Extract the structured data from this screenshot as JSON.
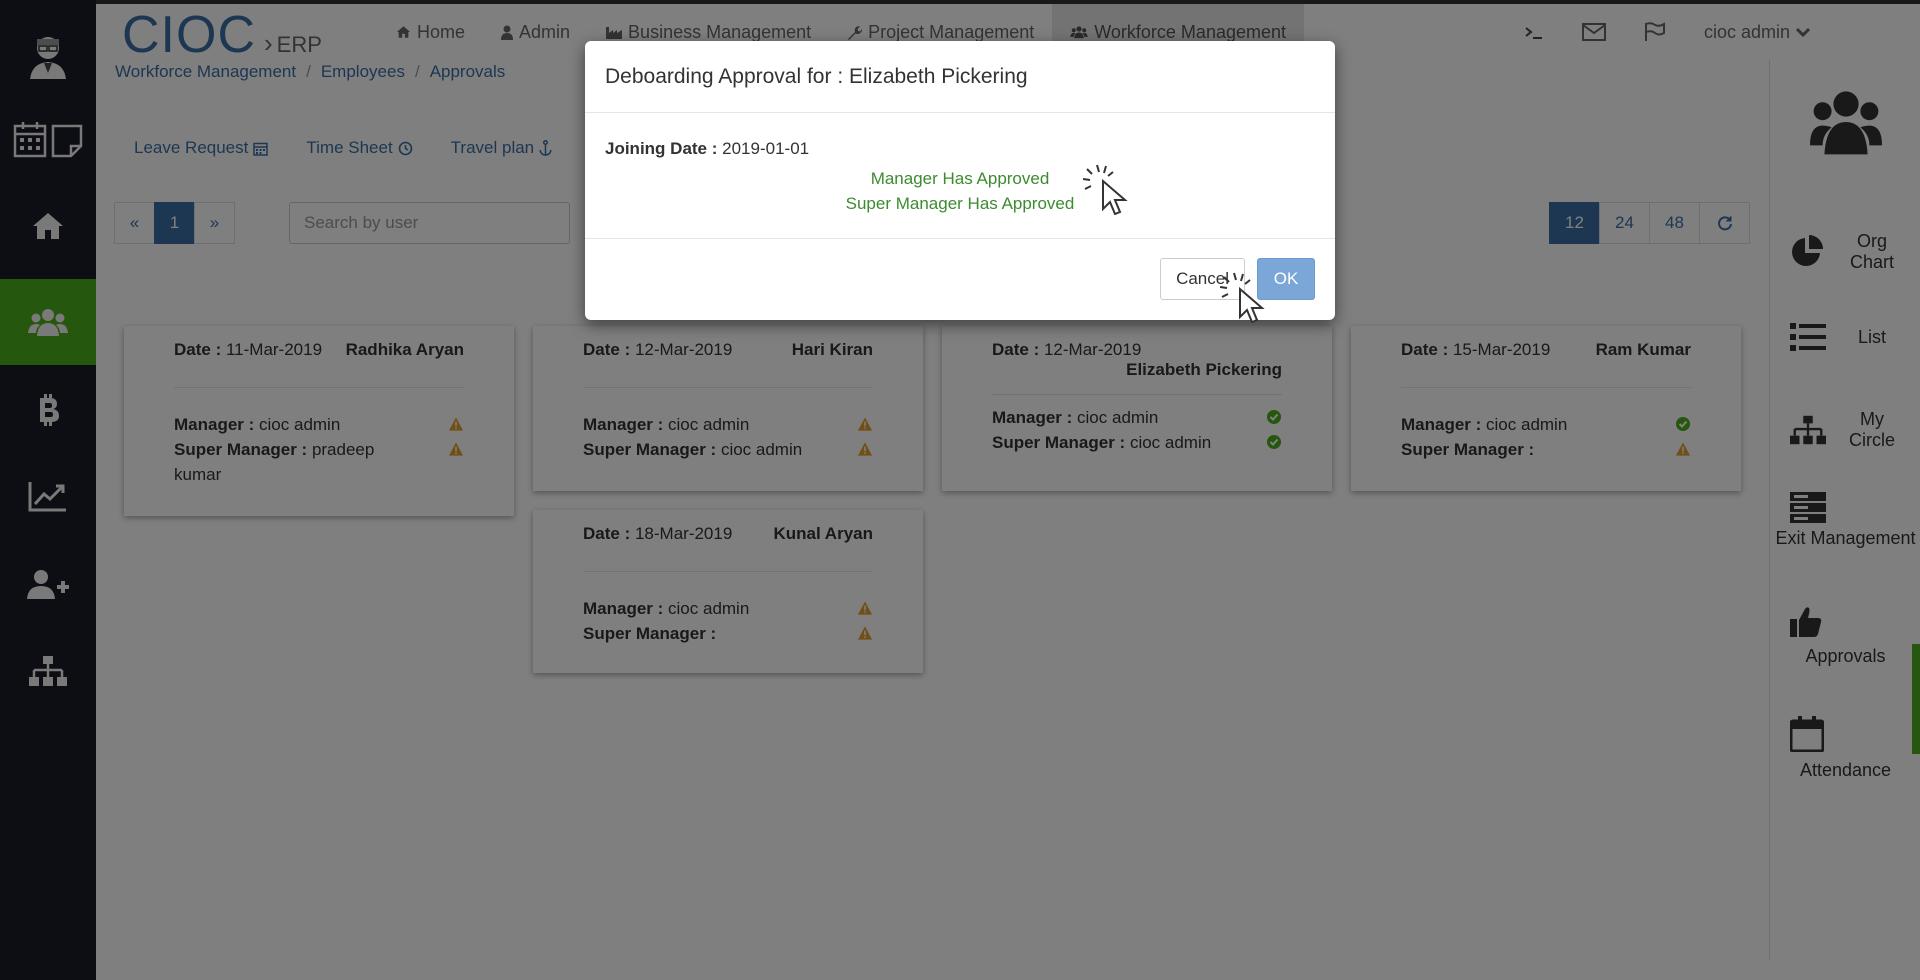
{
  "brand": {
    "main": "CIOC",
    "sub": "ERP"
  },
  "nav": [
    {
      "label": "Home",
      "icon": "home-icon"
    },
    {
      "label": "Admin",
      "icon": "user-icon"
    },
    {
      "label": "Business Management",
      "icon": "industry-icon"
    },
    {
      "label": "Project Management",
      "icon": "wrench-icon"
    },
    {
      "label": "Workforce Management",
      "icon": "users-icon",
      "active": true
    }
  ],
  "top_right": {
    "terminal_icon": "terminal-icon",
    "mail_icon": "envelope-icon",
    "flag_icon": "flag-icon",
    "user": "cioc admin"
  },
  "breadcrumb": [
    "Workforce Management",
    "Employees",
    "Approvals"
  ],
  "subtabs": [
    {
      "label": "Leave Request",
      "icon": "calendar-icon"
    },
    {
      "label": "Time Sheet",
      "icon": "clock-icon"
    },
    {
      "label": "Travel plan",
      "icon": "anchor-icon"
    }
  ],
  "pager": {
    "prev": "«",
    "current": "1",
    "next": "»"
  },
  "search": {
    "placeholder": "Search by user"
  },
  "page_sizes": [
    "12",
    "24",
    "48"
  ],
  "cards": [
    {
      "date_label": "Date :",
      "date": "11-Mar-2019",
      "name": "Radhika Aryan",
      "manager_label": "Manager :",
      "manager": "cioc admin",
      "super_label": "Super Manager :",
      "super": "pradeep kumar",
      "manager_status": "pending",
      "super_status": "pending"
    },
    {
      "date_label": "Date :",
      "date": "12-Mar-2019",
      "name": "Hari Kiran",
      "manager_label": "Manager :",
      "manager": "cioc admin",
      "super_label": "Super Manager :",
      "super": "cioc admin",
      "manager_status": "pending",
      "super_status": "pending"
    },
    {
      "date_label": "Date :",
      "date": "12-Mar-2019",
      "name": "Elizabeth Pickering",
      "manager_label": "Manager :",
      "manager": "cioc admin",
      "super_label": "Super Manager :",
      "super": "cioc admin",
      "manager_status": "approved",
      "super_status": "approved"
    },
    {
      "date_label": "Date :",
      "date": "15-Mar-2019",
      "name": "Ram Kumar",
      "manager_label": "Manager :",
      "manager": "cioc admin",
      "super_label": "Super Manager :",
      "super": "",
      "manager_status": "approved",
      "super_status": "pending"
    },
    {
      "date_label": "Date :",
      "date": "18-Mar-2019",
      "name": "Kunal Aryan",
      "manager_label": "Manager :",
      "manager": "cioc admin",
      "super_label": "Super Manager :",
      "super": "",
      "manager_status": "pending",
      "super_status": "pending"
    }
  ],
  "right_panel": [
    {
      "label": "Org Chart",
      "icon": "pie-chart-icon"
    },
    {
      "label": "List",
      "icon": "list-icon"
    },
    {
      "label": "My Circle",
      "icon": "sitemap-icon"
    },
    {
      "label": "Exit Management",
      "icon": "server-icon"
    },
    {
      "label": "Approvals",
      "icon": "thumbs-up-icon"
    },
    {
      "label": "Attendance",
      "icon": "calendar-icon"
    }
  ],
  "modal": {
    "title": "Deboarding Approval for : Elizabeth Pickering",
    "joining_label": "Joining Date :",
    "joining_date": "2019-01-01",
    "manager_status": "Manager Has Approved",
    "super_status": "Super Manager Has Approved",
    "cancel": "Cancel",
    "ok": "OK"
  },
  "colors": {
    "sidebar": "#1b1d27",
    "accent_green": "#4cae1f",
    "link_blue": "#3a6ea5",
    "approved_text": "#3d8b2f",
    "warning": "#e0a030",
    "check": "#4cae1f"
  }
}
